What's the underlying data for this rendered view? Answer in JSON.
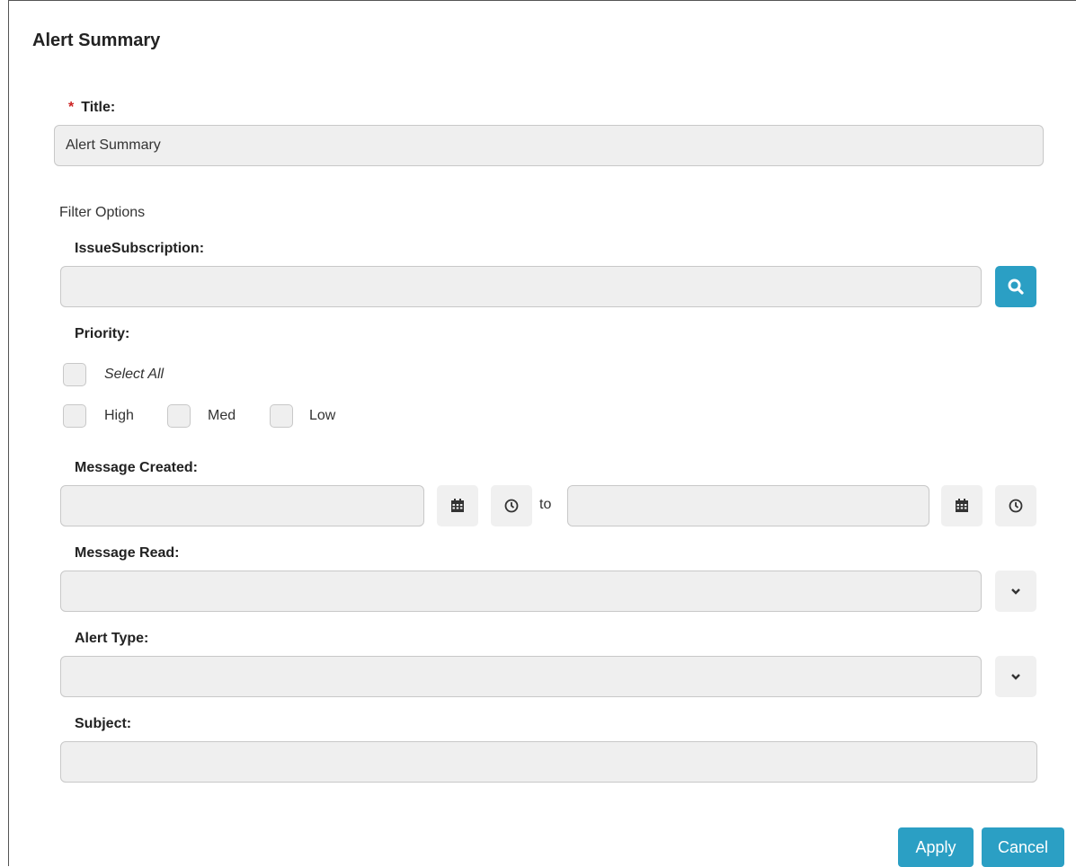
{
  "dialog": {
    "title": "Alert Summary"
  },
  "title_field": {
    "required_mark": "*",
    "label": "Title:",
    "value": "Alert Summary"
  },
  "filter_options": {
    "heading": "Filter Options"
  },
  "issue_subscription": {
    "label": "IssueSubscription:",
    "value": "",
    "search_icon": "search-icon"
  },
  "priority": {
    "label": "Priority:",
    "select_all": "Select All",
    "options": [
      "High",
      "Med",
      "Low"
    ]
  },
  "message_created": {
    "label": "Message Created:",
    "from_value": "",
    "to_label": "to",
    "to_value": "",
    "calendar_icon": "calendar-icon",
    "clock_icon": "clock-icon"
  },
  "message_read": {
    "label": "Message Read:",
    "value": ""
  },
  "alert_type": {
    "label": "Alert Type:",
    "value": ""
  },
  "subject": {
    "label": "Subject:",
    "value": ""
  },
  "actions": {
    "apply": "Apply",
    "cancel": "Cancel"
  },
  "colors": {
    "accent": "#2b9fc4",
    "required": "#cc2222",
    "field_bg": "#efefef"
  }
}
